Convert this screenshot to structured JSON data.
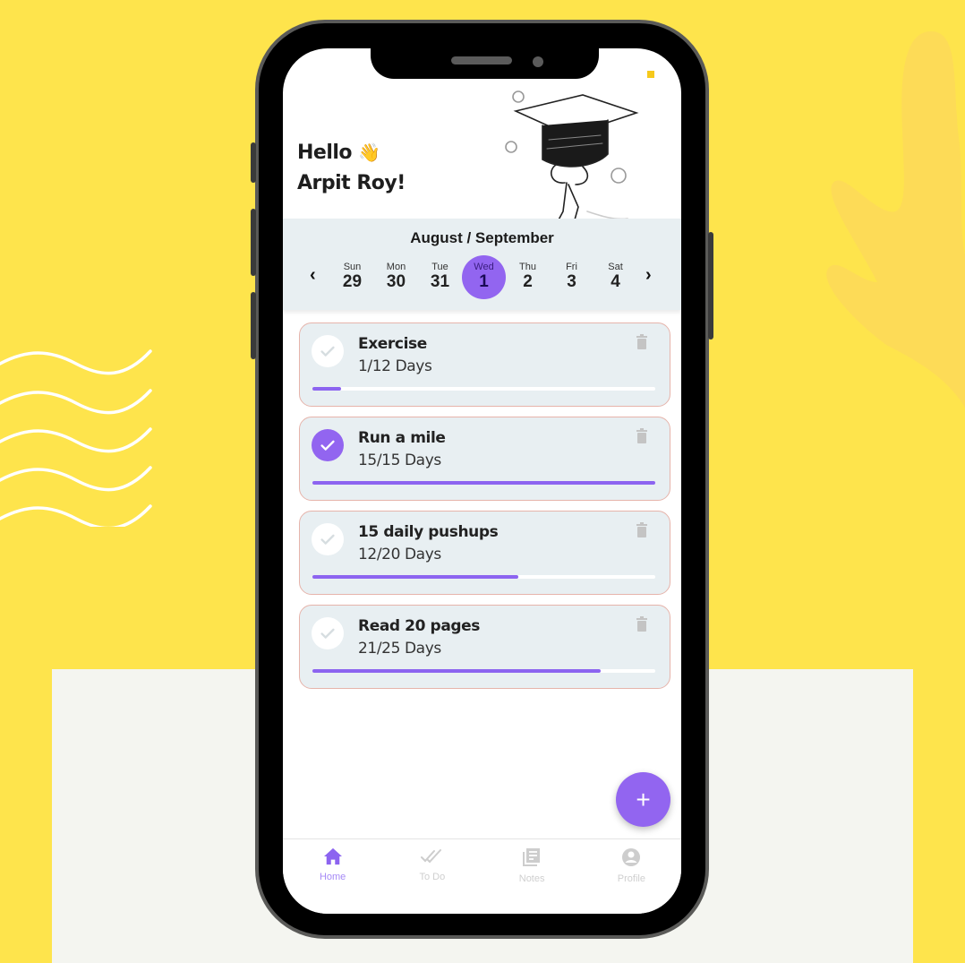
{
  "colors": {
    "background_yellow": "#FEE44C",
    "accent_purple": "#9265F0",
    "card_bg": "#E8EFF2",
    "card_border": "#E6B4AB",
    "inactive_gray": "#cfcfcf"
  },
  "header": {
    "greeting_line1": "Hello",
    "greeting_emoji": "👋",
    "greeting_line2": "Arpit Roy!"
  },
  "calendar": {
    "title": "August / September",
    "prev_icon": "chevron-left",
    "next_icon": "chevron-right",
    "days": [
      {
        "name": "Sun",
        "date": "29",
        "selected": false
      },
      {
        "name": "Mon",
        "date": "30",
        "selected": false
      },
      {
        "name": "Tue",
        "date": "31",
        "selected": false
      },
      {
        "name": "Wed",
        "date": "1",
        "selected": true
      },
      {
        "name": "Thu",
        "date": "2",
        "selected": false
      },
      {
        "name": "Fri",
        "date": "3",
        "selected": false
      },
      {
        "name": "Sat",
        "date": "4",
        "selected": false
      }
    ]
  },
  "habits": [
    {
      "title": "Exercise",
      "progress_text": "1/12 Days",
      "done": 1,
      "total": 12,
      "checked": false
    },
    {
      "title": "Run a mile",
      "progress_text": "15/15 Days",
      "done": 15,
      "total": 15,
      "checked": true
    },
    {
      "title": "15 daily pushups",
      "progress_text": "12/20 Days",
      "done": 12,
      "total": 20,
      "checked": false
    },
    {
      "title": "Read 20 pages",
      "progress_text": "21/25 Days",
      "done": 21,
      "total": 25,
      "checked": false
    }
  ],
  "fab": {
    "label": "+"
  },
  "nav": [
    {
      "label": "Home",
      "icon": "home-icon",
      "active": true
    },
    {
      "label": "To Do",
      "icon": "double-check-icon",
      "active": false
    },
    {
      "label": "Notes",
      "icon": "notes-icon",
      "active": false
    },
    {
      "label": "Profile",
      "icon": "profile-icon",
      "active": false
    }
  ]
}
